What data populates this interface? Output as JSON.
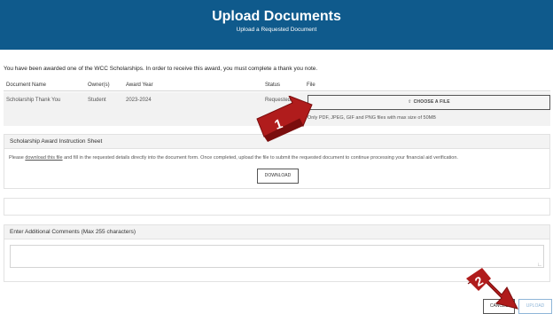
{
  "header": {
    "title": "Upload Documents",
    "subtitle": "Upload a Requested Document"
  },
  "intro_text": "You have been awarded one of the WCC Scholarships. In order to receive this award, you must complete a thank you note.",
  "table": {
    "columns": [
      "Document Name",
      "Owner(s)",
      "Award Year",
      "Status",
      "File"
    ],
    "row": {
      "document_name": "Scholarship Thank You",
      "owner": "Student",
      "award_year": "2023-2024",
      "status": "Requested",
      "choose_file_label": "CHOOSE A FILE",
      "file_hint": "Only PDF, JPEG, GIF and PNG files with max size of 50MB"
    }
  },
  "instructions_panel": {
    "title": "Scholarship Award Instruction Sheet",
    "text_before_link": "Please ",
    "link_text": "download this file",
    "text_after_link": " and fill in the requested details directly into the document form. Once completed, upload the file to submit the requested document to continue processing your financial aid verification.",
    "download_label": "DOWNLOAD"
  },
  "comments_panel": {
    "title": "Enter Additional Comments (Max 255 characters)",
    "value": ""
  },
  "footer": {
    "cancel_label": "CANCEL",
    "upload_label": "UPLOAD"
  },
  "callouts": [
    "1",
    "2"
  ],
  "colors": {
    "header_bg": "#0f5a8c",
    "callout_red": "#b01c1c",
    "upload_disabled": "#8fb6d8"
  },
  "icons": [
    "upload-icon",
    "resize-grip-icon",
    "arrow-callout-icon"
  ]
}
